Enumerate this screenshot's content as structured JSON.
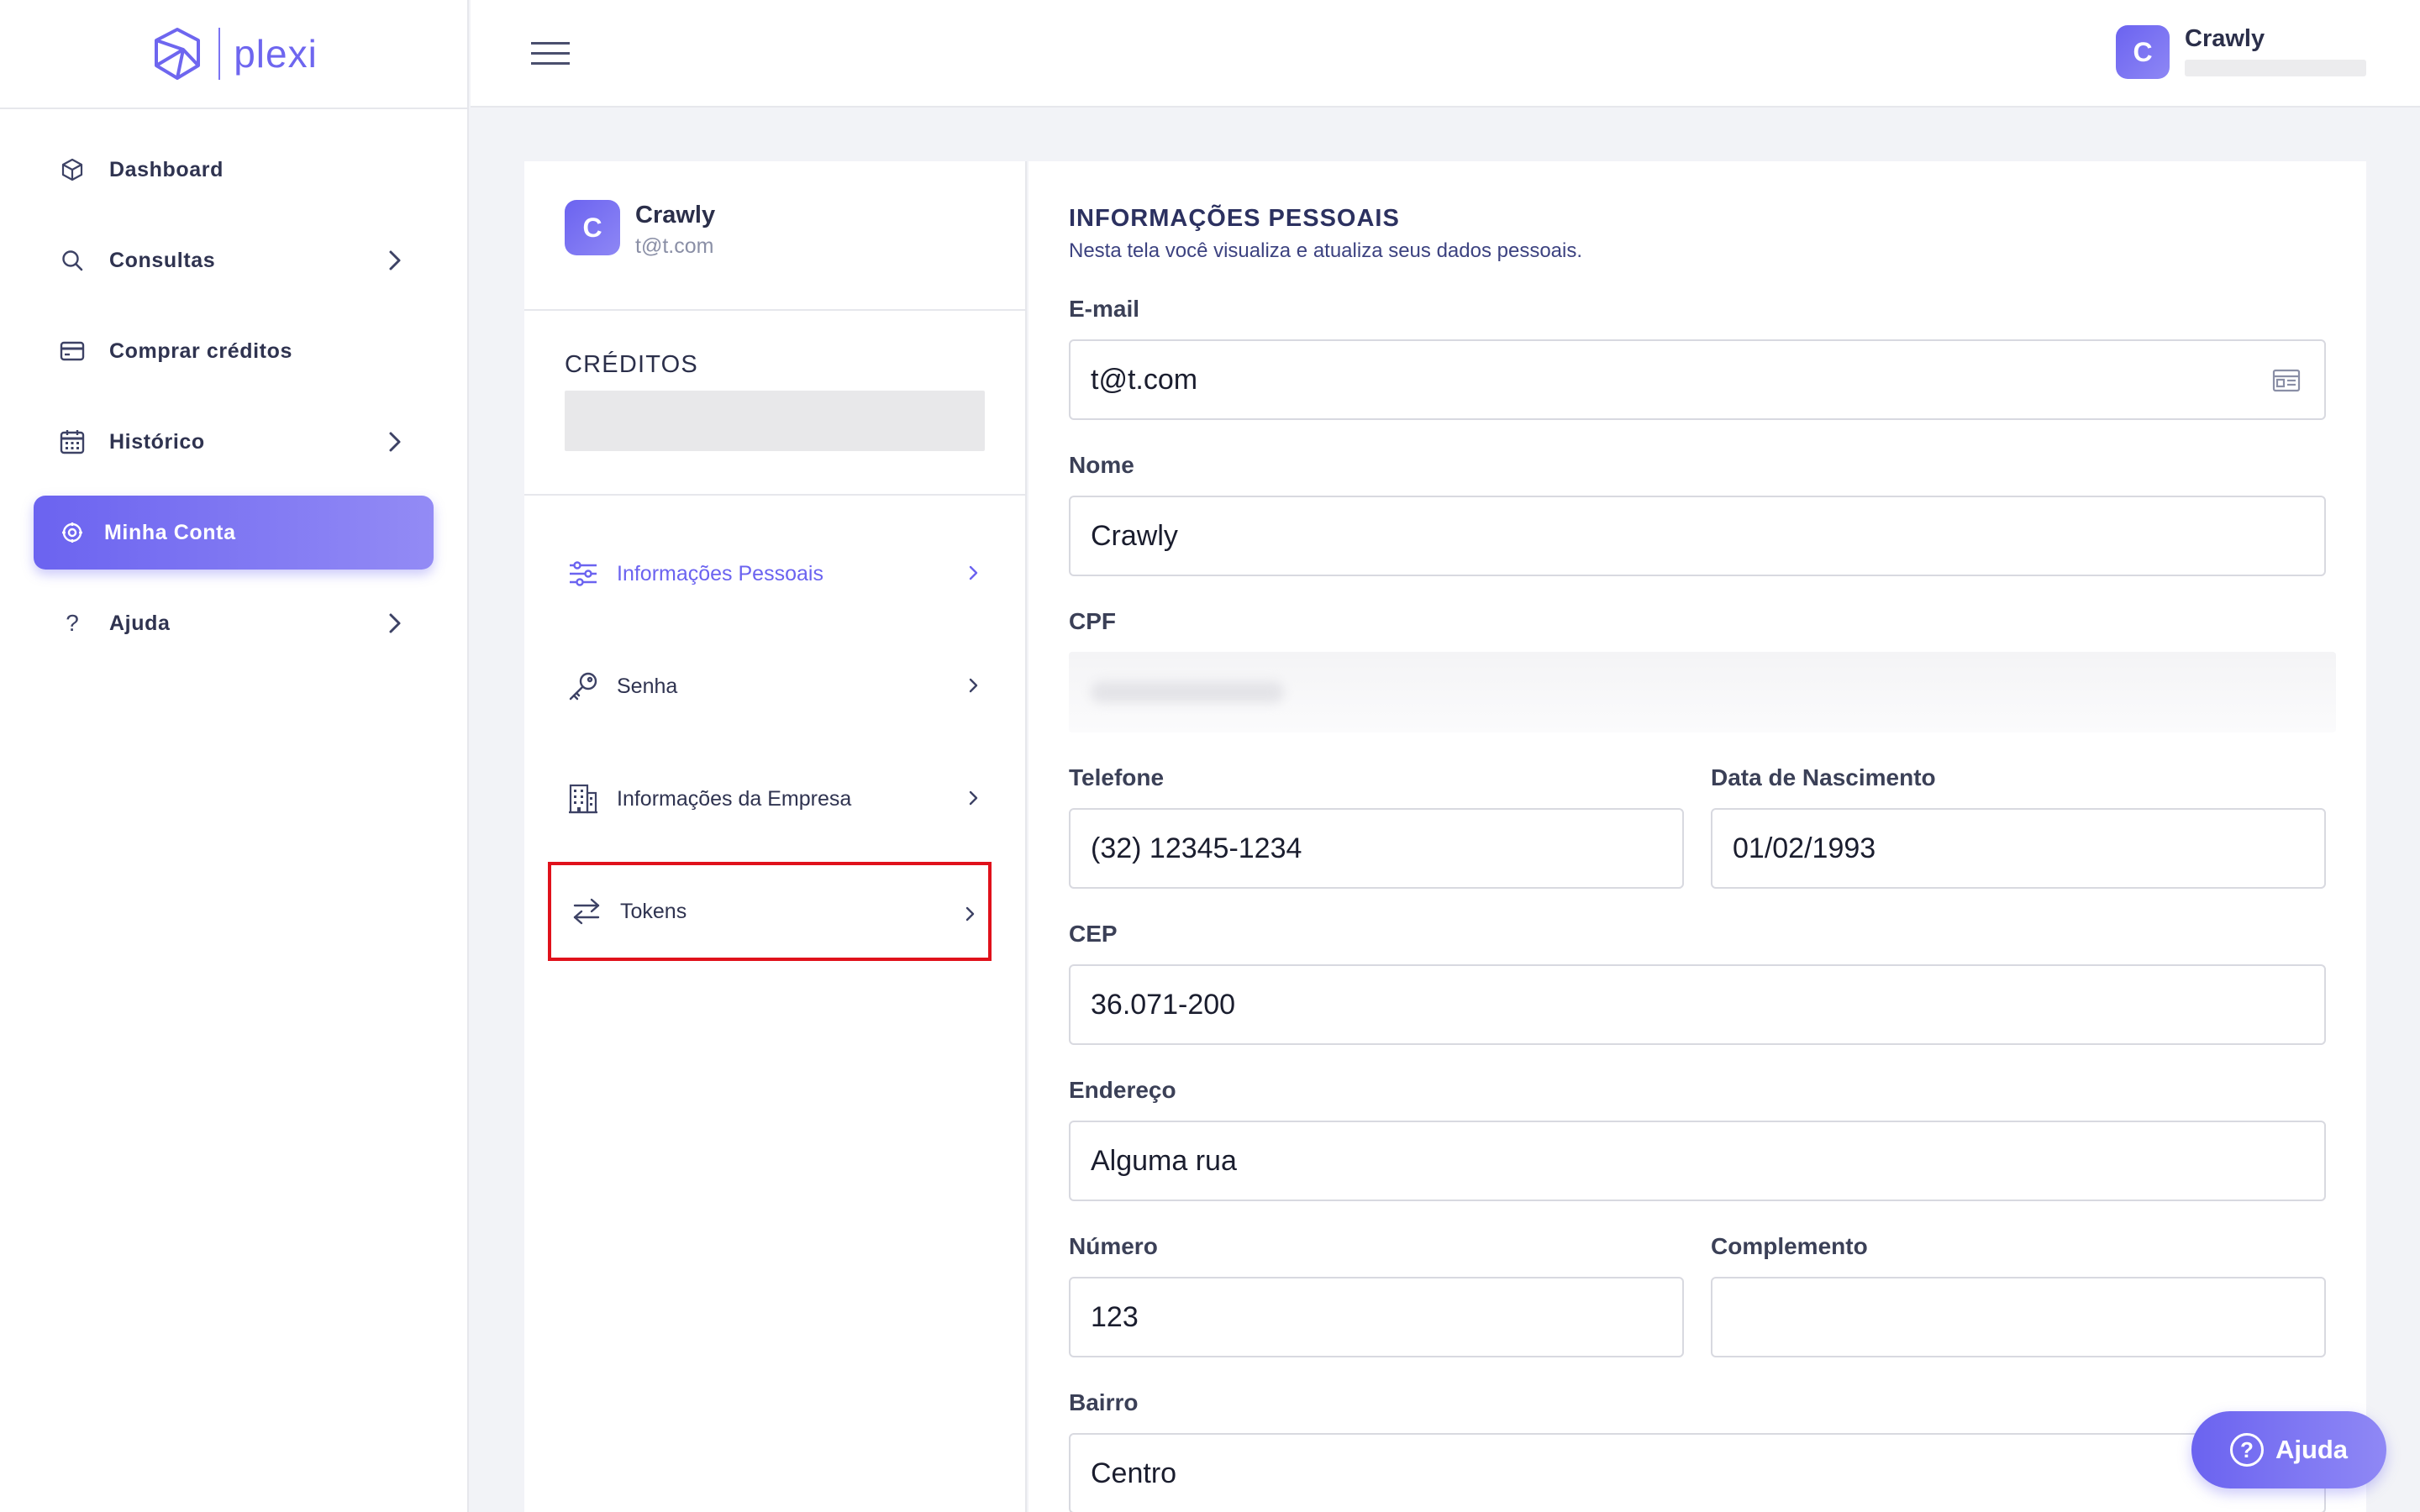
{
  "app": {
    "logo_text": "plexi"
  },
  "sidebar": {
    "items": [
      {
        "label": "Dashboard",
        "icon": "cube-icon",
        "has_submenu": false
      },
      {
        "label": "Consultas",
        "icon": "search-icon",
        "has_submenu": true
      },
      {
        "label": "Comprar créditos",
        "icon": "credit-card-icon",
        "has_submenu": false
      },
      {
        "label": "Histórico",
        "icon": "calendar-icon",
        "has_submenu": true
      },
      {
        "label": "Minha Conta",
        "icon": "settings-icon",
        "has_submenu": false,
        "active": true
      },
      {
        "label": "Ajuda",
        "icon": "question-icon",
        "has_submenu": true
      }
    ]
  },
  "topbar": {
    "user_name": "Crawly",
    "avatar_initial": "C"
  },
  "profile": {
    "name": "Crawly",
    "email": "t@t.com",
    "avatar_initial": "C"
  },
  "credits": {
    "title": "CRÉDITOS"
  },
  "account_menu": {
    "items": [
      {
        "label": "Informações Pessoais",
        "icon": "sliders-icon",
        "active": true
      },
      {
        "label": "Senha",
        "icon": "key-icon"
      },
      {
        "label": "Informações da Empresa",
        "icon": "building-icon"
      },
      {
        "label": "Tokens",
        "icon": "transfer-arrows-icon",
        "highlighted": true
      }
    ]
  },
  "form": {
    "title": "INFORMAÇÕES PESSOAIS",
    "subtitle": "Nesta tela você visualiza e atualiza seus dados pessoais.",
    "email": {
      "label": "E-mail",
      "value": "t@t.com"
    },
    "nome": {
      "label": "Nome",
      "value": "Crawly"
    },
    "cpf": {
      "label": "CPF"
    },
    "telefone": {
      "label": "Telefone",
      "value": "(32) 12345-1234"
    },
    "nascimento": {
      "label": "Data de Nascimento",
      "value": "01/02/1993"
    },
    "cep": {
      "label": "CEP",
      "value": "36.071-200"
    },
    "endereco": {
      "label": "Endereço",
      "value": "Alguma rua"
    },
    "numero": {
      "label": "Número",
      "value": "123"
    },
    "complemento": {
      "label": "Complemento",
      "value": ""
    },
    "bairro": {
      "label": "Bairro",
      "value": "Centro"
    }
  },
  "help_button": {
    "label": "Ajuda"
  },
  "colors": {
    "accent": "#6b63f0",
    "highlight_border": "#e0111b",
    "heading": "#2c3160"
  }
}
